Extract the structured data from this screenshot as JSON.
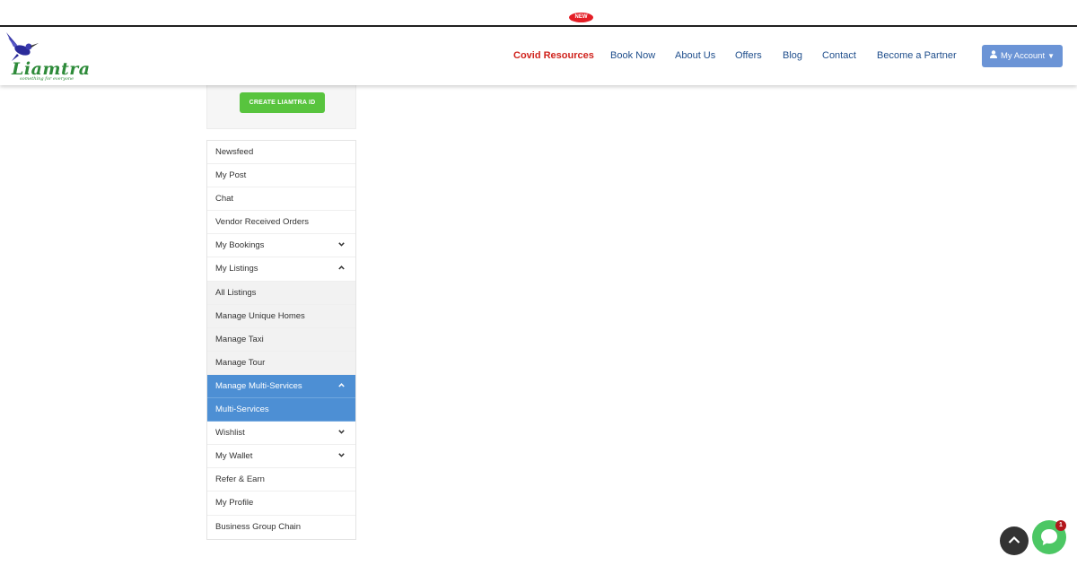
{
  "logo": {
    "text": "Liamtra",
    "tagline": "something for everyone"
  },
  "nav": {
    "items": [
      {
        "label": "Covid Resources",
        "badge": "NEW"
      },
      {
        "label": "Book Now"
      },
      {
        "label": "About Us"
      },
      {
        "label": "Offers"
      },
      {
        "label": "Blog"
      },
      {
        "label": "Contact"
      },
      {
        "label": "Become a Partner"
      }
    ],
    "account_label": "My Account"
  },
  "sidebar": {
    "create_id_label": "CREATE LIAMTRA ID",
    "items": [
      {
        "label": "Newsfeed"
      },
      {
        "label": "My Post"
      },
      {
        "label": "Chat"
      },
      {
        "label": "Vendor Received Orders"
      },
      {
        "label": "My Bookings",
        "chevron": "down"
      },
      {
        "label": "My Listings",
        "chevron": "up"
      },
      {
        "label": "All Listings",
        "sub": true
      },
      {
        "label": "Manage Unique Homes",
        "sub": true
      },
      {
        "label": "Manage Taxi",
        "sub": true
      },
      {
        "label": "Manage Tour",
        "sub": true
      },
      {
        "label": "Manage Multi-Services",
        "chevron": "up",
        "active": true
      },
      {
        "label": "Multi-Services",
        "active": true
      },
      {
        "label": "Wishlist",
        "chevron": "down"
      },
      {
        "label": "My Wallet",
        "chevron": "down"
      },
      {
        "label": "Refer & Earn"
      },
      {
        "label": "My Profile"
      },
      {
        "label": "Business Group Chain"
      }
    ]
  },
  "chat": {
    "unread_count": "1"
  },
  "colors": {
    "accent": "#4d8fd4",
    "create_button": "#58c43e",
    "covid": "#d0231d",
    "nav_link": "#1f4e8c"
  },
  "icons": {
    "user": "user-icon",
    "scroll": "chevron-up-icon",
    "chat": "chat-bubble-icon"
  }
}
